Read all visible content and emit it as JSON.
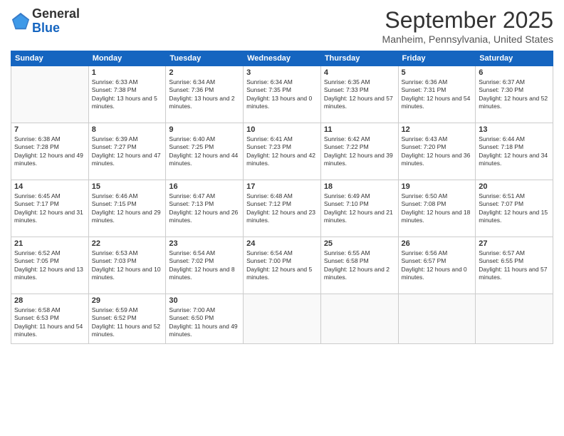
{
  "logo": {
    "general": "General",
    "blue": "Blue"
  },
  "title": "September 2025",
  "location": "Manheim, Pennsylvania, United States",
  "days_of_week": [
    "Sunday",
    "Monday",
    "Tuesday",
    "Wednesday",
    "Thursday",
    "Friday",
    "Saturday"
  ],
  "weeks": [
    [
      {
        "day": "",
        "sunrise": "",
        "sunset": "",
        "daylight": ""
      },
      {
        "day": "1",
        "sunrise": "Sunrise: 6:33 AM",
        "sunset": "Sunset: 7:38 PM",
        "daylight": "Daylight: 13 hours and 5 minutes."
      },
      {
        "day": "2",
        "sunrise": "Sunrise: 6:34 AM",
        "sunset": "Sunset: 7:36 PM",
        "daylight": "Daylight: 13 hours and 2 minutes."
      },
      {
        "day": "3",
        "sunrise": "Sunrise: 6:34 AM",
        "sunset": "Sunset: 7:35 PM",
        "daylight": "Daylight: 13 hours and 0 minutes."
      },
      {
        "day": "4",
        "sunrise": "Sunrise: 6:35 AM",
        "sunset": "Sunset: 7:33 PM",
        "daylight": "Daylight: 12 hours and 57 minutes."
      },
      {
        "day": "5",
        "sunrise": "Sunrise: 6:36 AM",
        "sunset": "Sunset: 7:31 PM",
        "daylight": "Daylight: 12 hours and 54 minutes."
      },
      {
        "day": "6",
        "sunrise": "Sunrise: 6:37 AM",
        "sunset": "Sunset: 7:30 PM",
        "daylight": "Daylight: 12 hours and 52 minutes."
      }
    ],
    [
      {
        "day": "7",
        "sunrise": "Sunrise: 6:38 AM",
        "sunset": "Sunset: 7:28 PM",
        "daylight": "Daylight: 12 hours and 49 minutes."
      },
      {
        "day": "8",
        "sunrise": "Sunrise: 6:39 AM",
        "sunset": "Sunset: 7:27 PM",
        "daylight": "Daylight: 12 hours and 47 minutes."
      },
      {
        "day": "9",
        "sunrise": "Sunrise: 6:40 AM",
        "sunset": "Sunset: 7:25 PM",
        "daylight": "Daylight: 12 hours and 44 minutes."
      },
      {
        "day": "10",
        "sunrise": "Sunrise: 6:41 AM",
        "sunset": "Sunset: 7:23 PM",
        "daylight": "Daylight: 12 hours and 42 minutes."
      },
      {
        "day": "11",
        "sunrise": "Sunrise: 6:42 AM",
        "sunset": "Sunset: 7:22 PM",
        "daylight": "Daylight: 12 hours and 39 minutes."
      },
      {
        "day": "12",
        "sunrise": "Sunrise: 6:43 AM",
        "sunset": "Sunset: 7:20 PM",
        "daylight": "Daylight: 12 hours and 36 minutes."
      },
      {
        "day": "13",
        "sunrise": "Sunrise: 6:44 AM",
        "sunset": "Sunset: 7:18 PM",
        "daylight": "Daylight: 12 hours and 34 minutes."
      }
    ],
    [
      {
        "day": "14",
        "sunrise": "Sunrise: 6:45 AM",
        "sunset": "Sunset: 7:17 PM",
        "daylight": "Daylight: 12 hours and 31 minutes."
      },
      {
        "day": "15",
        "sunrise": "Sunrise: 6:46 AM",
        "sunset": "Sunset: 7:15 PM",
        "daylight": "Daylight: 12 hours and 29 minutes."
      },
      {
        "day": "16",
        "sunrise": "Sunrise: 6:47 AM",
        "sunset": "Sunset: 7:13 PM",
        "daylight": "Daylight: 12 hours and 26 minutes."
      },
      {
        "day": "17",
        "sunrise": "Sunrise: 6:48 AM",
        "sunset": "Sunset: 7:12 PM",
        "daylight": "Daylight: 12 hours and 23 minutes."
      },
      {
        "day": "18",
        "sunrise": "Sunrise: 6:49 AM",
        "sunset": "Sunset: 7:10 PM",
        "daylight": "Daylight: 12 hours and 21 minutes."
      },
      {
        "day": "19",
        "sunrise": "Sunrise: 6:50 AM",
        "sunset": "Sunset: 7:08 PM",
        "daylight": "Daylight: 12 hours and 18 minutes."
      },
      {
        "day": "20",
        "sunrise": "Sunrise: 6:51 AM",
        "sunset": "Sunset: 7:07 PM",
        "daylight": "Daylight: 12 hours and 15 minutes."
      }
    ],
    [
      {
        "day": "21",
        "sunrise": "Sunrise: 6:52 AM",
        "sunset": "Sunset: 7:05 PM",
        "daylight": "Daylight: 12 hours and 13 minutes."
      },
      {
        "day": "22",
        "sunrise": "Sunrise: 6:53 AM",
        "sunset": "Sunset: 7:03 PM",
        "daylight": "Daylight: 12 hours and 10 minutes."
      },
      {
        "day": "23",
        "sunrise": "Sunrise: 6:54 AM",
        "sunset": "Sunset: 7:02 PM",
        "daylight": "Daylight: 12 hours and 8 minutes."
      },
      {
        "day": "24",
        "sunrise": "Sunrise: 6:54 AM",
        "sunset": "Sunset: 7:00 PM",
        "daylight": "Daylight: 12 hours and 5 minutes."
      },
      {
        "day": "25",
        "sunrise": "Sunrise: 6:55 AM",
        "sunset": "Sunset: 6:58 PM",
        "daylight": "Daylight: 12 hours and 2 minutes."
      },
      {
        "day": "26",
        "sunrise": "Sunrise: 6:56 AM",
        "sunset": "Sunset: 6:57 PM",
        "daylight": "Daylight: 12 hours and 0 minutes."
      },
      {
        "day": "27",
        "sunrise": "Sunrise: 6:57 AM",
        "sunset": "Sunset: 6:55 PM",
        "daylight": "Daylight: 11 hours and 57 minutes."
      }
    ],
    [
      {
        "day": "28",
        "sunrise": "Sunrise: 6:58 AM",
        "sunset": "Sunset: 6:53 PM",
        "daylight": "Daylight: 11 hours and 54 minutes."
      },
      {
        "day": "29",
        "sunrise": "Sunrise: 6:59 AM",
        "sunset": "Sunset: 6:52 PM",
        "daylight": "Daylight: 11 hours and 52 minutes."
      },
      {
        "day": "30",
        "sunrise": "Sunrise: 7:00 AM",
        "sunset": "Sunset: 6:50 PM",
        "daylight": "Daylight: 11 hours and 49 minutes."
      },
      {
        "day": "",
        "sunrise": "",
        "sunset": "",
        "daylight": ""
      },
      {
        "day": "",
        "sunrise": "",
        "sunset": "",
        "daylight": ""
      },
      {
        "day": "",
        "sunrise": "",
        "sunset": "",
        "daylight": ""
      },
      {
        "day": "",
        "sunrise": "",
        "sunset": "",
        "daylight": ""
      }
    ]
  ]
}
